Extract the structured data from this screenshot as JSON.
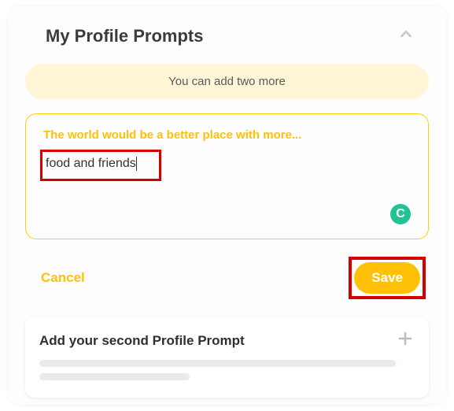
{
  "header": {
    "title": "My Profile Prompts"
  },
  "banner": {
    "text": "You can add two more"
  },
  "prompt": {
    "label": "The world would be a better place with more...",
    "value": "food and friends",
    "badge": "C"
  },
  "actions": {
    "cancel": "Cancel",
    "save": "Save"
  },
  "add": {
    "title": "Add your second Profile Prompt"
  }
}
